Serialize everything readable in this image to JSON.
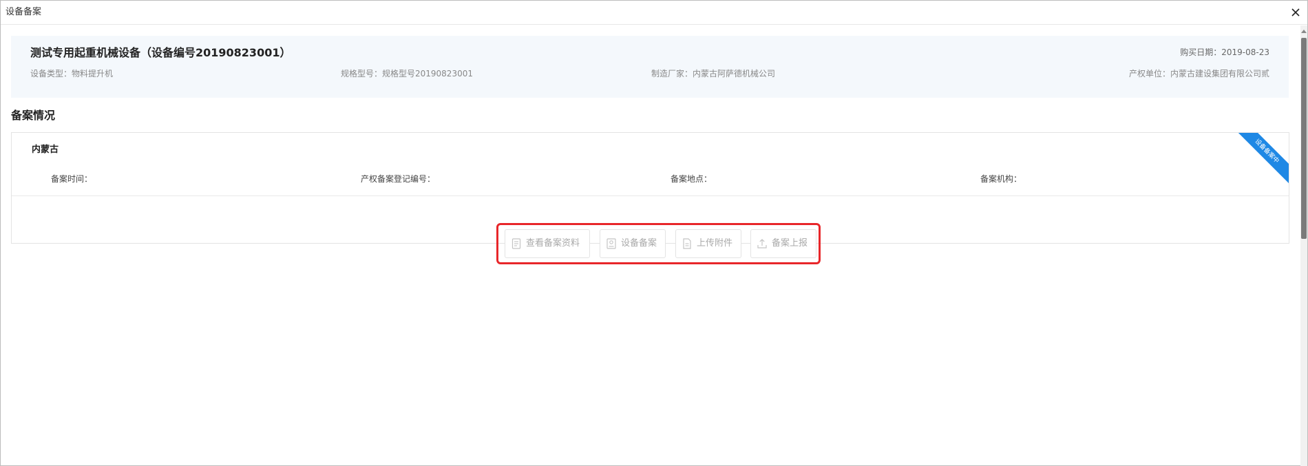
{
  "window": {
    "title": "设备备案"
  },
  "device": {
    "title": "测试专用起重机械设备（设备编号20190823001）",
    "purchase_date": "购买日期：2019-08-23",
    "type": "设备类型：物料提升机",
    "spec": "规格型号：规格型号20190823001",
    "manufacturer": "制造厂家：内蒙古阿萨德机械公司",
    "owner": "产权单位：内蒙古建设集团有限公司贰"
  },
  "section": {
    "title": "备案情况"
  },
  "record": {
    "region": "内蒙古",
    "ribbon": "设备备案中",
    "fields": {
      "time": "备案时间：",
      "reg_no": "产权备案登记编号：",
      "location": "备案地点：",
      "org": "备案机构："
    }
  },
  "actions": {
    "view_docs": "查看备案资料",
    "record": "设备备案",
    "upload": "上传附件",
    "report": "备案上报"
  },
  "colors": {
    "accent": "#1e88e5",
    "highlight": "#e8262a",
    "card_bg": "#f4f8fc",
    "disabled_text": "#a9a9a9"
  },
  "icons": [
    "close-icon",
    "document-icon",
    "id-card-icon",
    "attachment-icon",
    "upload-icon"
  ]
}
